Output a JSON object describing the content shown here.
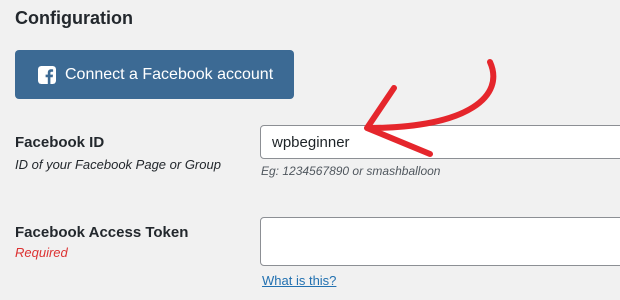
{
  "config": {
    "title": "Configuration",
    "connect_button_label": "Connect a Facebook account",
    "facebook_icon": "facebook-square-icon"
  },
  "facebook_id": {
    "label": "Facebook ID",
    "description": "ID of your Facebook Page or Group",
    "value": "wpbeginner",
    "help": "Eg: 1234567890 or smashballoon"
  },
  "access_token": {
    "label": "Facebook Access Token",
    "required": "Required",
    "value": "",
    "help_link": "What is this?"
  },
  "colors": {
    "button_bg": "#3c6a94",
    "required_red": "#dc3232",
    "link_blue": "#2271b1",
    "annotation_arrow": "#e5262c"
  }
}
